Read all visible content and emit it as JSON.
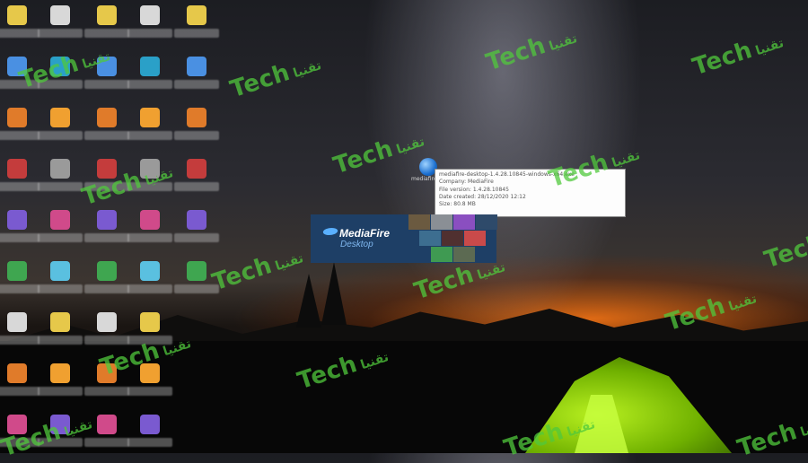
{
  "desktop": {
    "mediafire_icon_label": "mediafire-desk..."
  },
  "tooltip": {
    "lines": [
      "mediafire-desktop-1.4.28.10845-windows-x64.exe",
      "Company: MediaFire",
      "File version: 1.4.28.10845",
      "Date created: 28/12/2020 12:12",
      "Size: 80.8 MB"
    ]
  },
  "banner": {
    "brand": "MediaFire",
    "subtitle": "Desktop"
  },
  "watermark": {
    "text": "Techتقنيا",
    "latin": "Tech",
    "arabic": "تقنيا"
  },
  "colors": {
    "banner_bg": "#1e3f66",
    "watermark": "#50c83c",
    "tent": "#8fd400"
  },
  "icons": {
    "desktop_icons": [
      "app-icon",
      "chrome-icon",
      "vlc-icon",
      "folder-icon",
      "file-icon",
      "settings-icon",
      "photos-icon",
      "store-icon",
      "edge-icon",
      "winrar-icon",
      "pdf-icon",
      "word-icon"
    ]
  }
}
